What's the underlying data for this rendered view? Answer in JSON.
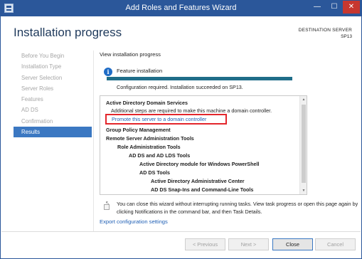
{
  "window": {
    "title": "Add Roles and Features Wizard",
    "controls": {
      "minimize": "—",
      "maximize": "☐",
      "close": "✕"
    }
  },
  "header": {
    "page_title": "Installation progress",
    "destination_label": "DESTINATION SERVER",
    "destination_server": "SP13"
  },
  "nav": {
    "items": [
      {
        "label": "Before You Begin",
        "active": false
      },
      {
        "label": "Installation Type",
        "active": false
      },
      {
        "label": "Server Selection",
        "active": false
      },
      {
        "label": "Server Roles",
        "active": false
      },
      {
        "label": "Features",
        "active": false
      },
      {
        "label": "AD DS",
        "active": false
      },
      {
        "label": "Confirmation",
        "active": false
      },
      {
        "label": "Results",
        "active": true
      }
    ]
  },
  "main": {
    "view_label": "View installation progress",
    "feature_label": "Feature installation",
    "progress_fraction": 1.0,
    "progress_text": "Configuration required. Installation succeeded on SP13.",
    "results": [
      {
        "text": "Active Directory Domain Services",
        "style": "bold"
      },
      {
        "text": "Additional steps are required to make this machine a domain controller.",
        "style": "plain"
      },
      {
        "text": "Promote this server to a domain controller",
        "style": "link"
      },
      {
        "text": "Group Policy Management",
        "style": "bold"
      },
      {
        "text": "Remote Server Administration Tools",
        "style": "bold"
      },
      {
        "text": "Role Administration Tools",
        "style": "bold"
      },
      {
        "text": "AD DS and AD LDS Tools",
        "style": "bold"
      },
      {
        "text": "Active Directory module for Windows PowerShell",
        "style": "bold"
      },
      {
        "text": "AD DS Tools",
        "style": "bold"
      },
      {
        "text": "Active Directory Administrative Center",
        "style": "bold"
      },
      {
        "text": "AD DS Snap-Ins and Command-Line Tools",
        "style": "bold"
      }
    ],
    "notice_text": "You can close this wizard without interrupting running tasks. View task progress or open this page again by clicking Notifications in the command bar, and then Task Details.",
    "export_link": "Export configuration settings"
  },
  "footer": {
    "previous_label": "< Previous",
    "next_label": "Next >",
    "close_label": "Close",
    "cancel_label": "Cancel"
  },
  "colors": {
    "titlebar": "#2b579a",
    "nav_active": "#3b78c2",
    "progress": "#1f6d89",
    "link": "#1f5fb5",
    "highlight": "#e3262c"
  }
}
